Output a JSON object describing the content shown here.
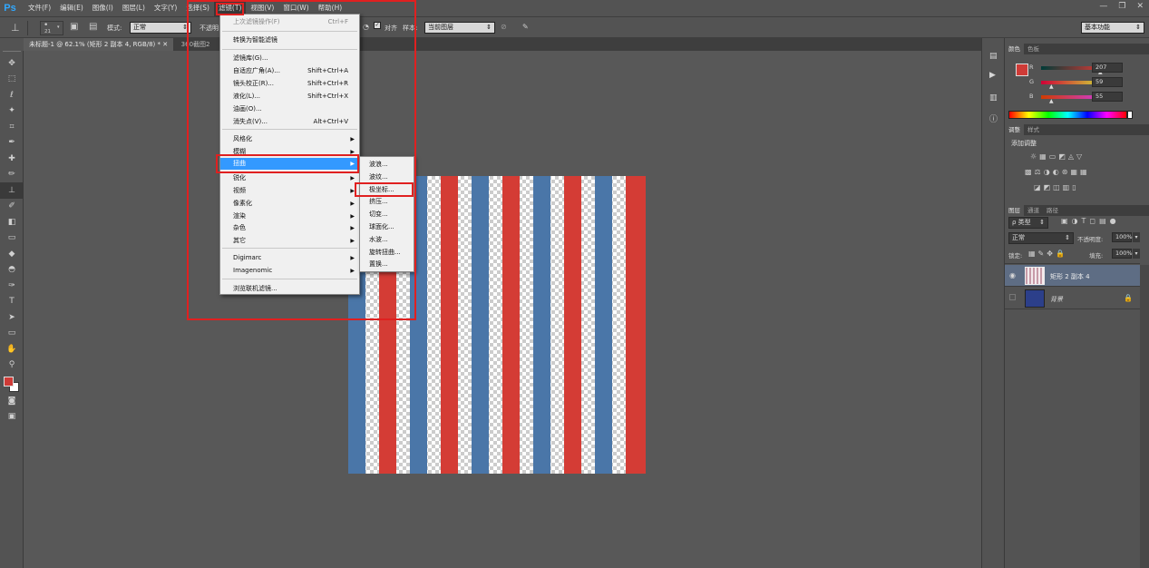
{
  "app": {
    "logo": "Ps",
    "menus": [
      "文件(F)",
      "编辑(E)",
      "图像(I)",
      "图层(L)",
      "文字(Y)",
      "选择(S)",
      "滤镜(T)",
      "视图(V)",
      "窗口(W)",
      "帮助(H)"
    ],
    "active_menu": "滤镜(T)"
  },
  "window_controls": {
    "minimize": "—",
    "restore": "❐",
    "close": "✕"
  },
  "options": {
    "brush_size": "21",
    "mode_label": "模式:",
    "mode_value": "正常",
    "opacity_label": "不透明",
    "align_label": "对齐",
    "sample_label": "样本:",
    "sample_value": "当前图层",
    "workspace_value": "基本功能"
  },
  "tabs": {
    "active": "未标题-1 @ 62.1% (矩形 2 副本 4, RGB/8) *",
    "other": "360截图2"
  },
  "filter_menu": {
    "items": [
      {
        "label": "上次滤镜操作(F)",
        "shortcut": "Ctrl+F",
        "disabled": true
      },
      {
        "label": "转换为智能滤镜"
      },
      {
        "label": "滤镜库(G)..."
      },
      {
        "label": "自适应广角(A)...",
        "shortcut": "Shift+Ctrl+A"
      },
      {
        "label": "镜头校正(R)...",
        "shortcut": "Shift+Ctrl+R"
      },
      {
        "label": "液化(L)...",
        "shortcut": "Shift+Ctrl+X"
      },
      {
        "label": "油画(O)..."
      },
      {
        "label": "消失点(V)...",
        "shortcut": "Alt+Ctrl+V"
      },
      {
        "label": "风格化",
        "sub": true
      },
      {
        "label": "模糊",
        "sub": true
      },
      {
        "label": "扭曲",
        "sub": true,
        "highlight": true
      },
      {
        "label": "锐化",
        "sub": true
      },
      {
        "label": "视频",
        "sub": true
      },
      {
        "label": "像素化",
        "sub": true
      },
      {
        "label": "渲染",
        "sub": true
      },
      {
        "label": "杂色",
        "sub": true
      },
      {
        "label": "其它",
        "sub": true
      },
      {
        "label": "Digimarc",
        "sub": true
      },
      {
        "label": "Imagenomic",
        "sub": true
      },
      {
        "label": "浏览联机滤镜..."
      }
    ]
  },
  "distort_submenu": {
    "items": [
      "波浪...",
      "波纹...",
      "极坐标...",
      "挤压...",
      "切变...",
      "球面化...",
      "水波...",
      "旋转扭曲...",
      "置换..."
    ],
    "selected": "极坐标..."
  },
  "canvas": {
    "colors": {
      "red": "#d43c35",
      "blue": "#4a76a8"
    }
  },
  "color_panel": {
    "tabs": [
      "颜色",
      "色板"
    ],
    "r_label": "R",
    "g_label": "G",
    "b_label": "B",
    "r": "207",
    "g": "59",
    "b": "55",
    "fg_color": "#cf3b37"
  },
  "adjust_panel": {
    "tabs": [
      "调整",
      "样式"
    ],
    "title": "添加调整"
  },
  "layers_panel": {
    "tabs": [
      "图层",
      "通道",
      "路径"
    ],
    "kind_label": "ρ 类型",
    "blend": "正常",
    "opacity_label": "不透明度:",
    "opacity": "100%",
    "lock_label": "锁定:",
    "fill_label": "填充:",
    "fill": "100%",
    "layers": [
      {
        "name": "矩形 2 副本 4",
        "visible": true,
        "selected": true
      },
      {
        "name": "背景",
        "locked": true
      }
    ]
  }
}
